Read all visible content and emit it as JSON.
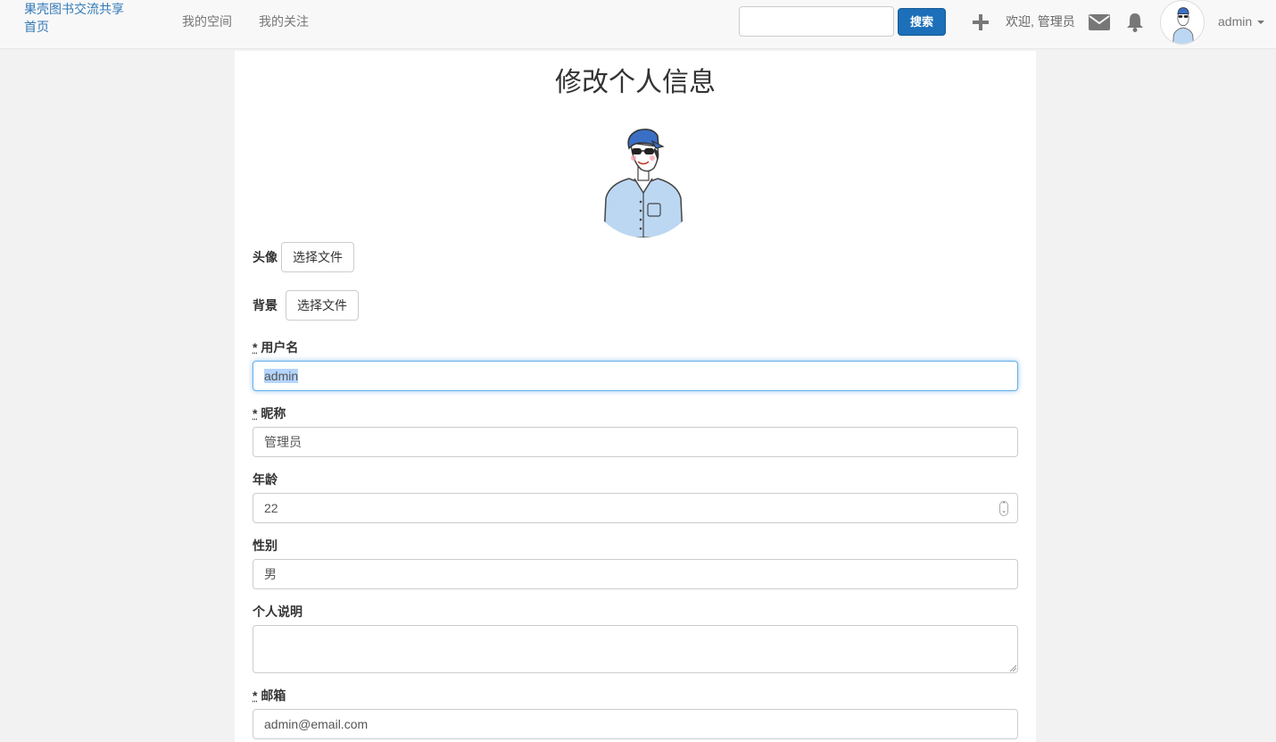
{
  "navbar": {
    "brand": "果壳图书交流共享首页",
    "links": [
      "我的空间",
      "我的关注"
    ],
    "search_placeholder": "",
    "search_button": "搜索",
    "welcome": "欢迎, 管理员",
    "username": "admin",
    "icons": [
      "plus-icon",
      "envelope-icon",
      "bell-icon"
    ]
  },
  "form": {
    "title": "修改个人信息",
    "avatar_label": "头像",
    "background_label": "背景",
    "file_button": "选择文件",
    "required_mark": "*",
    "username_label": "用户名",
    "username_value": "admin",
    "nickname_label": "昵称",
    "nickname_value": "管理员",
    "age_label": "年龄",
    "age_value": "22",
    "gender_label": "性别",
    "gender_value": "男",
    "bio_label": "个人说明",
    "bio_value": "",
    "email_label": "邮箱",
    "email_value": "admin@email.com"
  },
  "colors": {
    "brand": "#337ab7",
    "primary_button": "#1c6fb8",
    "focus_border": "#66afe9"
  }
}
